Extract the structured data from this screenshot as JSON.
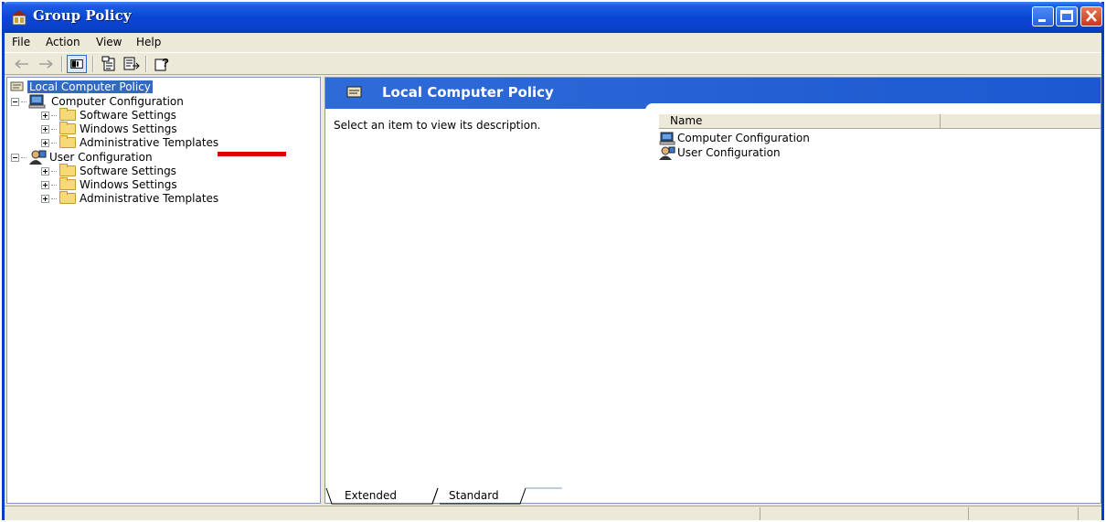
{
  "window": {
    "title": "Group Policy"
  },
  "menu": [
    "File",
    "Action",
    "View",
    "Help"
  ],
  "toolbar": {
    "buttons": [
      "back-arrow-icon",
      "forward-arrow-icon",
      "show-hide-tree-icon",
      "properties-icon",
      "export-list-icon",
      "help-icon"
    ]
  },
  "tree": {
    "root": "Local Computer Policy",
    "computer": {
      "label": "Computer Configuration",
      "children": [
        "Software Settings",
        "Windows Settings",
        "Administrative Templates"
      ]
    },
    "user": {
      "label": "User Configuration",
      "children": [
        "Software Settings",
        "Windows Settings",
        "Administrative Templates"
      ]
    }
  },
  "details": {
    "header_title": "Local Computer Policy",
    "description": "Select an item to view its description.",
    "columns": [
      "Name"
    ],
    "items": [
      "Computer Configuration",
      "User Configuration"
    ]
  },
  "tabs": [
    "Extended",
    "Standard"
  ],
  "colors": {
    "titlebar": "#0a46d6",
    "header": "#2f6bd8",
    "selection": "#316ac5",
    "annotation_mark": "#e00000"
  }
}
